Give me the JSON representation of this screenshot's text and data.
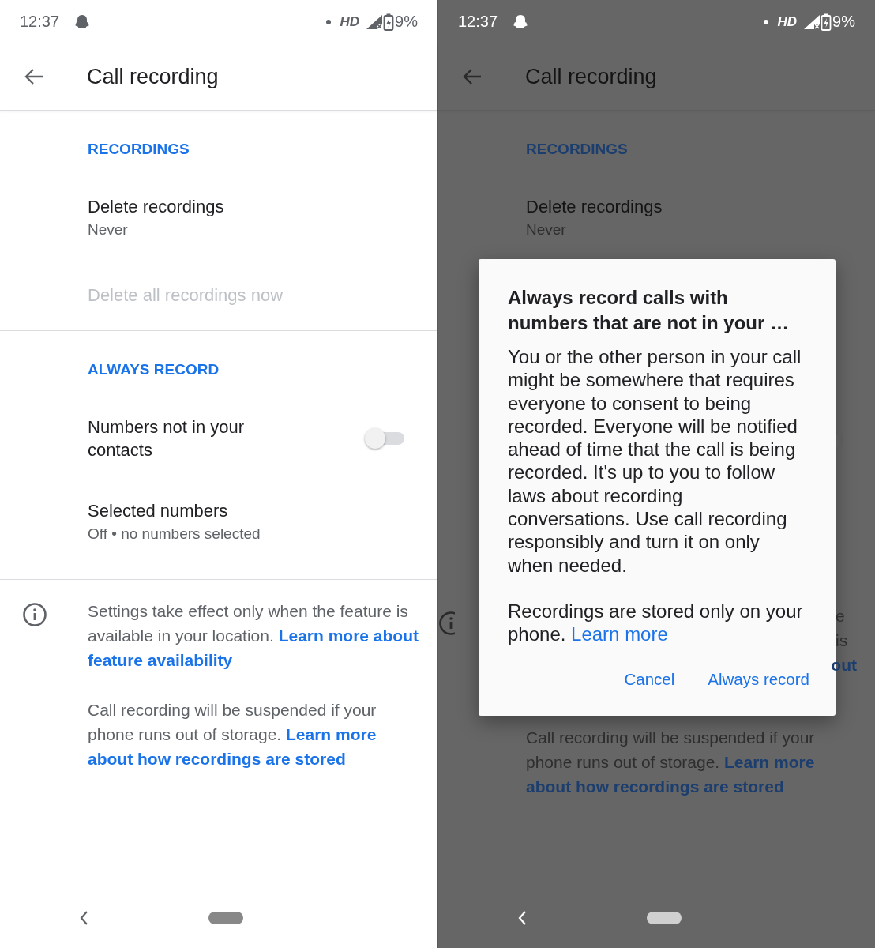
{
  "screens": [
    {
      "dimmed": false,
      "status_bar": {
        "time": "12:37",
        "network": "HD",
        "battery": "9%"
      },
      "toolbar": {
        "title": "Call recording"
      },
      "sections": [
        {
          "header": "RECORDINGS",
          "items": [
            {
              "kind": "detail",
              "title": "Delete recordings",
              "subtitle": "Never",
              "disabled": false
            },
            {
              "kind": "detail",
              "title": "Delete all recordings now",
              "disabled": true
            }
          ]
        },
        {
          "header": "ALWAYS RECORD",
          "items": [
            {
              "kind": "switch",
              "title": "Numbers not in your contacts",
              "on": false,
              "disabled": false
            },
            {
              "kind": "detail",
              "title": "Selected numbers",
              "subtitle": "Off • no numbers selected",
              "disabled": false
            }
          ]
        }
      ],
      "notes": [
        {
          "text": "Settings take effect only when the feature is available in your location.",
          "link": [
            "Learn more about",
            "feature availability"
          ]
        },
        {
          "text": "Call recording will be suspended if your phone runs out of storage.",
          "link": [
            "Learn more",
            "about how recordings are stored"
          ]
        }
      ]
    },
    {
      "dimmed": true,
      "status_bar": {
        "time": "12:37",
        "network": "HD",
        "battery": "9%"
      },
      "toolbar": {
        "title": "Call recording"
      },
      "sections": [
        {
          "header": "RECORDINGS",
          "items": [
            {
              "kind": "detail",
              "title": "Delete recordings",
              "subtitle": "Never",
              "disabled": false
            }
          ]
        }
      ],
      "dialog": {
        "title": "Always record calls with numbers that are not in your …",
        "paragraphs": [
          {
            "text": "You or the other person in your call might be somewhere that requires everyone to consent to being recorded. Everyone will be notified ahead of time that the call is being recorded. It's up to you to follow laws about recording conversations. Use call recording responsibly and turn it on only when needed."
          },
          {
            "text": "Recordings are stored only on your phone.",
            "link": [
              "Learn more"
            ]
          }
        ],
        "buttons": [
          {
            "label": "Cancel"
          },
          {
            "label": "Always record"
          }
        ]
      },
      "edge_fragments": [
        {
          "kind": "switch",
          "on": false
        },
        {
          "kind": "text",
          "text": "e is"
        },
        {
          "kind": "link",
          "text": "out"
        }
      ],
      "notes": [
        {
          "text": "Call recording will be suspended if your phone runs out of storage.",
          "link": [
            "Learn more",
            "about how recordings are stored"
          ]
        }
      ]
    }
  ]
}
